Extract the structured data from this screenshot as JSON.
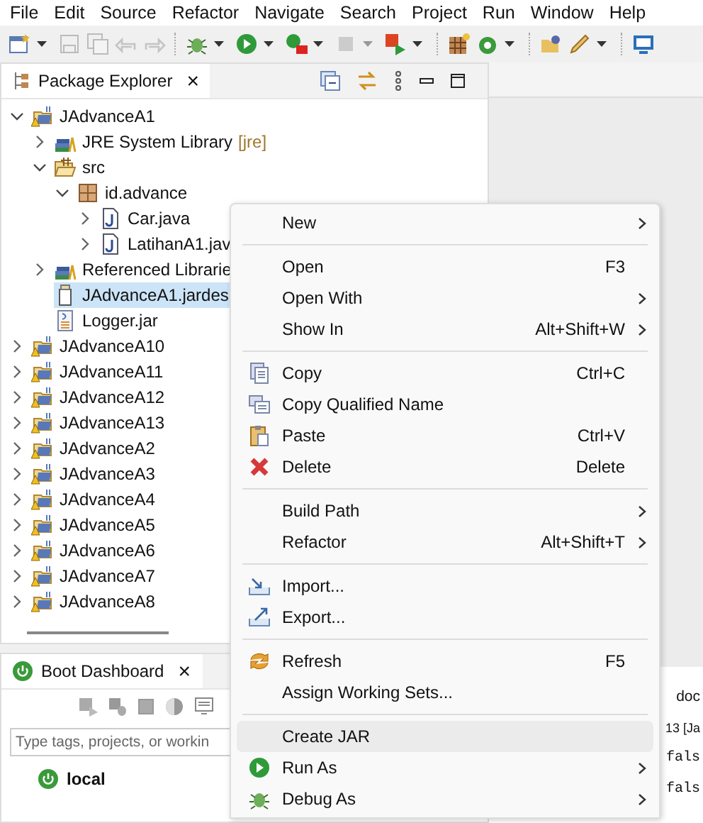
{
  "menu_bar": [
    "File",
    "Edit",
    "Source",
    "Refactor",
    "Navigate",
    "Search",
    "Project",
    "Run",
    "Window",
    "Help"
  ],
  "explorer": {
    "tab": {
      "label": "Package Explorer",
      "close": "×",
      "selected": true
    },
    "tree": [
      {
        "label": "JAdvanceA1",
        "kind": "project",
        "expanded": true,
        "selected": false,
        "children": [
          {
            "label": "JRE System Library",
            "decoration": "[jre]",
            "kind": "library",
            "expanded": false,
            "selected": false
          },
          {
            "label": "src",
            "kind": "source-folder",
            "expanded": true,
            "selected": false,
            "children": [
              {
                "label": "id.advance",
                "kind": "package",
                "expanded": true,
                "selected": false,
                "children": [
                  {
                    "label": "Car.java",
                    "kind": "java",
                    "expanded": false,
                    "selected": false
                  },
                  {
                    "label": "LatihanA1.jav",
                    "kind": "java",
                    "expanded": false,
                    "selected": false
                  }
                ]
              }
            ]
          },
          {
            "label": "Referenced Librarie",
            "kind": "library",
            "expanded": false,
            "selected": false
          },
          {
            "label": "JAdvanceA1.jardes",
            "kind": "jardesc",
            "selected": true
          },
          {
            "label": "Logger.jar",
            "kind": "jar",
            "selected": false
          }
        ]
      },
      {
        "label": "JAdvanceA10",
        "kind": "project",
        "expanded": false,
        "selected": false
      },
      {
        "label": "JAdvanceA11",
        "kind": "project",
        "expanded": false,
        "selected": false
      },
      {
        "label": "JAdvanceA12",
        "kind": "project",
        "expanded": false,
        "selected": false
      },
      {
        "label": "JAdvanceA13",
        "kind": "project",
        "expanded": false,
        "selected": false
      },
      {
        "label": "JAdvanceA2",
        "kind": "project",
        "expanded": false,
        "selected": false
      },
      {
        "label": "JAdvanceA3",
        "kind": "project",
        "expanded": false,
        "selected": false
      },
      {
        "label": "JAdvanceA4",
        "kind": "project",
        "expanded": false,
        "selected": false
      },
      {
        "label": "JAdvanceA5",
        "kind": "project",
        "expanded": false,
        "selected": false
      },
      {
        "label": "JAdvanceA6",
        "kind": "project",
        "expanded": false,
        "selected": false
      },
      {
        "label": "JAdvanceA7",
        "kind": "project",
        "expanded": false,
        "selected": false
      },
      {
        "label": "JAdvanceA8",
        "kind": "project",
        "expanded": false,
        "selected": false
      }
    ]
  },
  "boot_dashboard": {
    "tab": {
      "label": "Boot Dashboard",
      "close": "×",
      "selected": true
    },
    "filter": {
      "placeholder": "Type tags, projects, or workin"
    },
    "items": [
      {
        "label": "local"
      }
    ]
  },
  "editor_fragments": {
    "tab": "doc",
    "lines": [
      "13 [Ja",
      "fals",
      "fals"
    ]
  },
  "context_menu": [
    {
      "kind": "item",
      "label": "New",
      "submenu": true,
      "selected": false
    },
    {
      "kind": "separator"
    },
    {
      "kind": "item",
      "label": "Open",
      "shortcut": "F3",
      "selected": false
    },
    {
      "kind": "item",
      "label": "Open With",
      "submenu": true,
      "selected": false
    },
    {
      "kind": "item",
      "label": "Show In",
      "shortcut": "Alt+Shift+W",
      "submenu": true,
      "selected": false
    },
    {
      "kind": "separator"
    },
    {
      "kind": "item",
      "label": "Copy",
      "shortcut": "Ctrl+C",
      "selected": false
    },
    {
      "kind": "item",
      "label": "Copy Qualified Name",
      "selected": false
    },
    {
      "kind": "item",
      "label": "Paste",
      "shortcut": "Ctrl+V",
      "selected": false
    },
    {
      "kind": "item",
      "label": "Delete",
      "shortcut": "Delete",
      "selected": false
    },
    {
      "kind": "separator"
    },
    {
      "kind": "item",
      "label": "Build Path",
      "submenu": true,
      "selected": false
    },
    {
      "kind": "item",
      "label": "Refactor",
      "shortcut": "Alt+Shift+T",
      "submenu": true,
      "selected": false
    },
    {
      "kind": "separator"
    },
    {
      "kind": "item",
      "label": "Import...",
      "selected": false
    },
    {
      "kind": "item",
      "label": "Export...",
      "selected": false
    },
    {
      "kind": "separator"
    },
    {
      "kind": "item",
      "label": "Refresh",
      "shortcut": "F5",
      "selected": false
    },
    {
      "kind": "item",
      "label": "Assign Working Sets...",
      "selected": false
    },
    {
      "kind": "separator"
    },
    {
      "kind": "item",
      "label": "Create JAR",
      "selected": true
    },
    {
      "kind": "item",
      "label": "Run As",
      "submenu": true,
      "selected": false
    },
    {
      "kind": "item",
      "label": "Debug As",
      "submenu": true,
      "selected": false
    }
  ]
}
